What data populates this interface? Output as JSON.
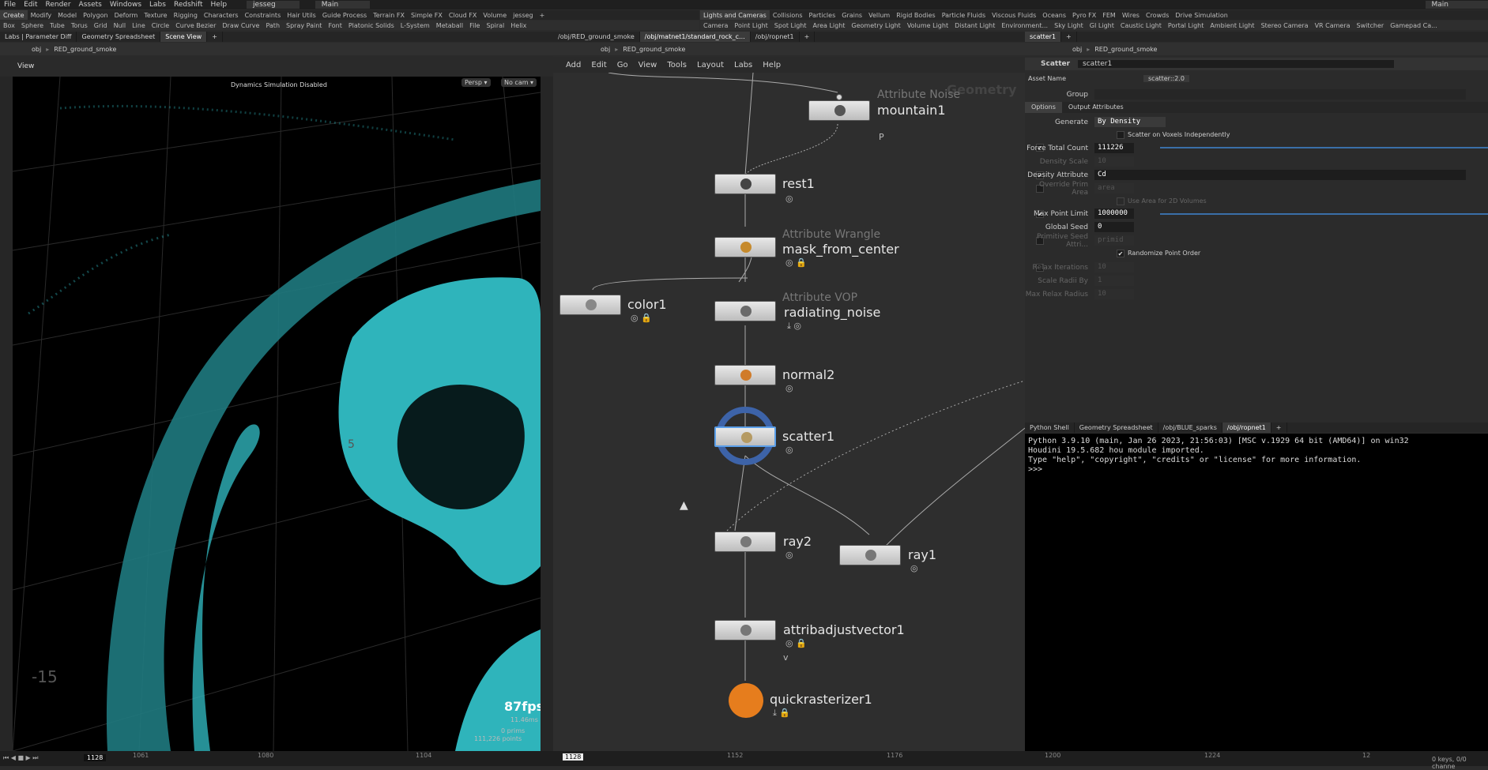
{
  "menubar": {
    "items": [
      "File",
      "Edit",
      "Render",
      "Assets",
      "Windows",
      "Labs",
      "Redshift",
      "Help"
    ],
    "user": "jesseg",
    "desktop": "Main",
    "right_desktop": "Main"
  },
  "shelf_left": {
    "tabs": [
      "Create",
      "Modify",
      "Model",
      "Polygon",
      "Deform",
      "Texture",
      "Rigging",
      "Characters",
      "Constraints",
      "Hair Utils",
      "Guide Process",
      "Terrain FX",
      "Simple FX",
      "Cloud FX",
      "Volume",
      "jesseg"
    ],
    "tools": [
      "Box",
      "Sphere",
      "Tube",
      "Torus",
      "Grid",
      "Null",
      "Line",
      "Circle",
      "Curve Bezier",
      "Draw Curve",
      "Path",
      "Spray Paint",
      "Font",
      "Platonic Solids",
      "L-System",
      "Metaball",
      "File",
      "Spiral",
      "Helix"
    ]
  },
  "shelf_right": {
    "tabs": [
      "Lights and Cameras",
      "Collisions",
      "Particles",
      "Grains",
      "Vellum",
      "Rigid Bodies",
      "Particle Fluids",
      "Viscous Fluids",
      "Oceans",
      "Pyro FX",
      "FEM",
      "Wires",
      "Crowds",
      "Drive Simulation"
    ],
    "tools": [
      "Camera",
      "Point Light",
      "Spot Light",
      "Area Light",
      "Geometry Light",
      "Volume Light",
      "Distant Light",
      "Environment...",
      "Sky Light",
      "GI Light",
      "Caustic Light",
      "Portal Light",
      "Ambient Light",
      "Stereo Camera",
      "VR Camera",
      "Switcher",
      "Gamepad Ca..."
    ]
  },
  "viewport": {
    "tabs": [
      "Labs | Parameter Diff",
      "Geometry Spreadsheet",
      "Scene View"
    ],
    "path": [
      "obj",
      "RED_ground_smoke"
    ],
    "title": "View",
    "status": "Dynamics Simulation Disabled",
    "persp": "Persp ▾",
    "cam": "No cam ▾",
    "fps": "87fps",
    "ms": "11.46ms",
    "prims": "0  prims",
    "points": "111,226 points",
    "grid_labels": [
      "-15",
      "5"
    ]
  },
  "network": {
    "tabs": [
      "/obj/RED_ground_smoke",
      "/obj/matnet1/standard_rock_c...",
      "/obj/ropnet1"
    ],
    "path": [
      "obj",
      "RED_ground_smoke"
    ],
    "menu": [
      "Add",
      "Edit",
      "Go",
      "View",
      "Tools",
      "Layout",
      "Labs",
      "Help"
    ],
    "context": "Geometry",
    "nodes": [
      {
        "type": "Attribute Noise",
        "name": "mountain1",
        "sub": "P"
      },
      {
        "type": "",
        "name": "rest1",
        "sub": ""
      },
      {
        "type": "Attribute Wrangle",
        "name": "mask_from_center",
        "sub": ""
      },
      {
        "type": "",
        "name": "color1",
        "sub": ""
      },
      {
        "type": "Attribute VOP",
        "name": "radiating_noise",
        "sub": ""
      },
      {
        "type": "",
        "name": "normal2",
        "sub": ""
      },
      {
        "type": "",
        "name": "scatter1",
        "sub": ""
      },
      {
        "type": "",
        "name": "ray2",
        "sub": ""
      },
      {
        "type": "",
        "name": "ray1",
        "sub": ""
      },
      {
        "type": "",
        "name": "attribadjustvector1",
        "sub": "v"
      },
      {
        "type": "",
        "name": "quickrasterizer1",
        "sub": ""
      }
    ]
  },
  "params": {
    "tab": "scatter1",
    "path": [
      "obj",
      "RED_ground_smoke"
    ],
    "node_type": "Scatter",
    "node_name": "scatter1",
    "asset_name_label": "Asset Name",
    "asset_name": "scatter::2.0",
    "group_label": "Group",
    "subtabs": [
      "Options",
      "Output Attributes"
    ],
    "generate_label": "Generate",
    "generate_value": "By Density",
    "voxels": "Scatter on Voxels Independently",
    "force_total_count": {
      "label": "Force Total Count",
      "value": "111226"
    },
    "density_scale": {
      "label": "Density Scale",
      "value": "10"
    },
    "density_attribute": {
      "label": "Density Attribute",
      "value": "Cd"
    },
    "override_prim_area": {
      "label": "Override Prim Area",
      "value": "area"
    },
    "use_area": "Use Area for 2D Volumes",
    "max_point_limit": {
      "label": "Max Point Limit",
      "value": "1000000"
    },
    "global_seed": {
      "label": "Global Seed",
      "value": "0"
    },
    "prim_seed": {
      "label": "Primitive Seed Attri...",
      "value": "primid"
    },
    "randomize": "Randomize Point Order",
    "relax_iterations": {
      "label": "Relax Iterations",
      "value": "10"
    },
    "scale_radii": {
      "label": "Scale Radii By",
      "value": "1"
    },
    "max_relax_radius": {
      "label": "Max Relax Radius",
      "value": "10"
    }
  },
  "console": {
    "tabs": [
      "Python Shell",
      "Geometry Spreadsheet",
      "/obj/BLUE_sparks",
      "/obj/ropnet1"
    ],
    "lines": [
      "Python 3.9.10 (main, Jan 26 2023, 21:56:03) [MSC v.1929 64 bit (AMD64)] on win32",
      "Houdini 19.5.682 hou module imported.",
      "Type \"help\", \"copyright\", \"credits\" or \"license\" for more information.",
      ">>>"
    ]
  },
  "timeline": {
    "frame": "1128",
    "cursor_frame": "1128",
    "ticks": [
      "1061",
      "1080",
      "1104",
      "1128",
      "1152",
      "1176",
      "1200",
      "1224",
      "12"
    ],
    "keys": "0 keys, 0/0 channe"
  },
  "colors": {
    "smoke": "#2fb4bb",
    "accent_blue": "#3d63a8",
    "orange": "#e67d1d"
  }
}
